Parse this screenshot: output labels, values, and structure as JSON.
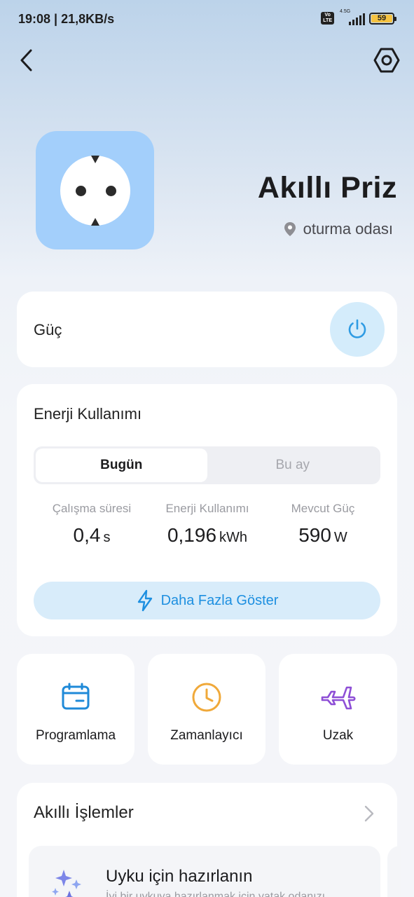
{
  "status_bar": {
    "time": "19:08 | 21,8KB/s",
    "network": "4.5G",
    "volte": "Vo LTE",
    "battery": "59"
  },
  "header": {
    "back_icon": "chevron-left-icon",
    "settings_icon": "hexagon-gear-icon"
  },
  "device": {
    "icon": "power-socket-icon",
    "name": "Akıllı Priz",
    "room": "oturma odası",
    "tile_color": "#a3cffb"
  },
  "power": {
    "label": "Güç",
    "icon": "power-icon",
    "button_color": "#d4ecfb"
  },
  "energy": {
    "title": "Enerji Kullanımı",
    "tabs": [
      {
        "label": "Bugün",
        "active": true
      },
      {
        "label": "Bu ay",
        "active": false
      }
    ],
    "stats": [
      {
        "label": "Çalışma süresi",
        "value": "0,4",
        "unit": "s"
      },
      {
        "label": "Enerji Kullanımı",
        "value": "0,196",
        "unit": "kWh"
      },
      {
        "label": "Mevcut Güç",
        "value": "590",
        "unit": "W"
      }
    ],
    "more_button": "Daha Fazla Göster",
    "more_icon": "lightning-icon",
    "accent": "#1d8fe0"
  },
  "features": [
    {
      "label": "Programlama",
      "icon": "calendar-icon",
      "color": "#1f8ad8"
    },
    {
      "label": "Zamanlayıcı",
      "icon": "clock-icon",
      "color": "#f0a93a"
    },
    {
      "label": "Uzak",
      "icon": "airplane-icon",
      "color": "#8e4fd6"
    }
  ],
  "smart": {
    "title": "Akıllı İşlemler",
    "scene": {
      "title": "Uyku için hazırlanın",
      "description": "İyi bir uykuya hazırlanmak için yatak odanızı",
      "icon": "sparkles-icon"
    }
  }
}
